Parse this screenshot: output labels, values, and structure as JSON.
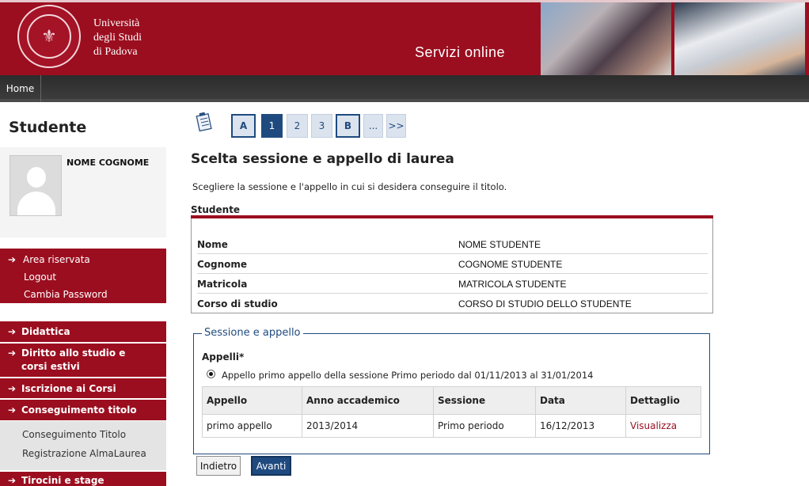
{
  "header": {
    "university_line1": "Università",
    "university_line2": "degli Studi",
    "university_line3": "di Padova",
    "service_title": "Servizi online",
    "brand_color": "#9b0e1f"
  },
  "nav": {
    "home": "Home"
  },
  "sidebar": {
    "title": "Studente",
    "user_name": "NOME COGNOME",
    "area": {
      "label": "Area riservata",
      "logout": "Logout",
      "change_password": "Cambia Password"
    },
    "menu": [
      {
        "label": "Didattica"
      },
      {
        "label": "Diritto allo studio e corsi estivi"
      },
      {
        "label": "Iscrizione ai Corsi"
      },
      {
        "label": "Conseguimento titolo"
      }
    ],
    "submenu": [
      {
        "label": "Conseguimento Titolo"
      },
      {
        "label": "Registrazione AlmaLaurea"
      }
    ],
    "last_item": "Tirocini e stage"
  },
  "pager": {
    "items": [
      "A",
      "1",
      "2",
      "3",
      "B",
      "...",
      ">>"
    ],
    "active": "1"
  },
  "main": {
    "title": "Scelta sessione e appello di laurea",
    "intro": "Scegliere la sessione e l'appello in cui si desidera conseguire il titolo.",
    "student_section": "Studente",
    "student_rows": [
      {
        "label": "Nome",
        "value": "NOME STUDENTE"
      },
      {
        "label": "Cognome",
        "value": "COGNOME STUDENTE"
      },
      {
        "label": "Matricola",
        "value": "MATRICOLA STUDENTE"
      },
      {
        "label": "Corso di studio",
        "value": "CORSO DI STUDIO DELLO STUDENTE"
      }
    ],
    "session_legend": "Sessione e appello",
    "appelli_label": "Appelli*",
    "radio_label": "Appello primo appello della sessione Primo periodo dal 01/11/2013 al 31/01/2014",
    "table": {
      "headers": [
        "Appello",
        "Anno accademico",
        "Sessione",
        "Data",
        "Dettaglio"
      ],
      "rows": [
        [
          "primo appello",
          "2013/2014",
          "Primo periodo",
          "16/12/2013",
          "Visualizza"
        ]
      ]
    },
    "buttons": {
      "back": "Indietro",
      "next": "Avanti"
    }
  }
}
